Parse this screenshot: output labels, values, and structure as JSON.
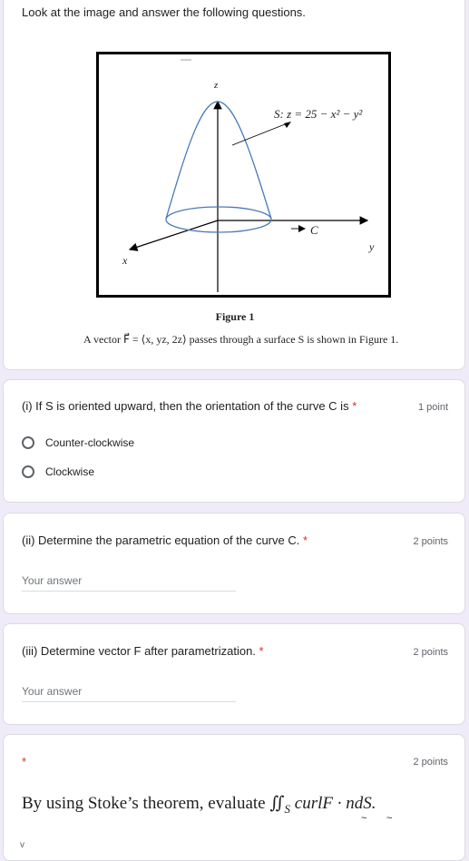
{
  "intro": {
    "text": "Look at the image and answer the following questions.",
    "figure": {
      "axis_z": "z",
      "axis_x": "x",
      "axis_y": "y",
      "surface_label": "S: z = 25 − x² − y²",
      "curve_label": "C",
      "caption": "Figure 1",
      "description": "A vector F⃗ = ⟨x, yz, 2z⟩ passes through a surface S is shown in Figure 1.",
      "paraboloid_color": "#4a7ab8"
    }
  },
  "questions": [
    {
      "title": "(i) If S is oriented upward, then the orientation of the curve C is",
      "required_mark": "*",
      "points": "1 point",
      "options": [
        "Counter-clockwise",
        "Clockwise"
      ]
    },
    {
      "title": "(ii) Determine the parametric equation of the curve C.",
      "required_mark": "*",
      "points": "2 points",
      "placeholder": "Your answer"
    },
    {
      "title": "(iii) Determine vector F after parametrization.",
      "required_mark": "*",
      "points": "2 points",
      "placeholder": "Your answer"
    },
    {
      "required_mark": "*",
      "points": "2 points",
      "prompt_prefix": "By using Stoke’s theorem, evaluate",
      "integral": "∬",
      "subscript": "S",
      "expression": "curlF · ndS."
    }
  ],
  "colors": {
    "background": "#f0ebf8",
    "required": "#d93025"
  }
}
